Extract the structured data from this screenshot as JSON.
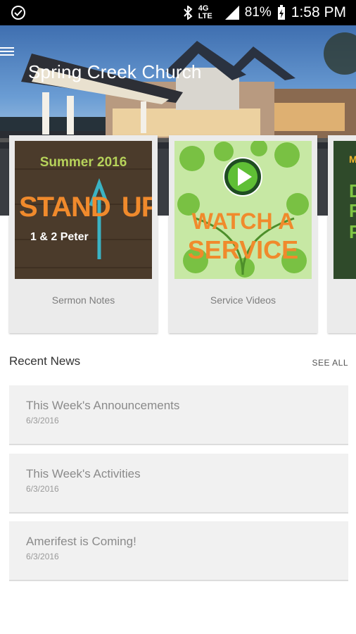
{
  "status_bar": {
    "battery": "81%",
    "network": "4G LTE",
    "time": "1:58 PM"
  },
  "header": {
    "title": "Spring Creek Church"
  },
  "cards": [
    {
      "label": "Sermon Notes",
      "art": {
        "line1": "Summer 2016",
        "line2": "STAND",
        "line3": "UP",
        "line4": "1 & 2 Peter"
      }
    },
    {
      "label": "Service Videos",
      "art": {
        "line1": "WATCH A",
        "line2": "SERVICE"
      }
    },
    {
      "label": "",
      "art": {
        "line1": "M",
        "line2": "D",
        "line3": "R",
        "line4": "P"
      }
    }
  ],
  "news": {
    "title": "Recent News",
    "see_all": "SEE ALL",
    "items": [
      {
        "title": "This Week's Announcements",
        "date": "6/3/2016"
      },
      {
        "title": "This Week's Activities",
        "date": "6/3/2016"
      },
      {
        "title": "Amerifest is Coming!",
        "date": "6/3/2016"
      }
    ]
  },
  "colors": {
    "status_bar": "#000000",
    "card_bg": "#ebebeb",
    "news_bg": "#f1f1f1",
    "accent_orange": "#f08a2c",
    "accent_teal": "#3ab3c4",
    "leaf_green": "#79c143"
  }
}
